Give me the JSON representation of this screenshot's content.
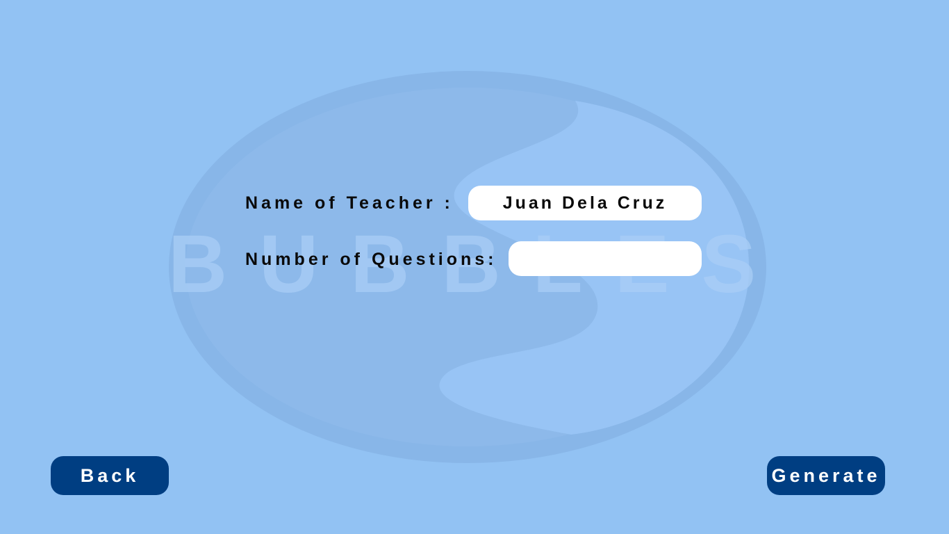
{
  "watermark": {
    "logo_text": "BUBBLES"
  },
  "form": {
    "teacher_label": "Name of Teacher :",
    "teacher_value": "Juan Dela Cruz",
    "questions_label": "Number of Questions:",
    "questions_value": ""
  },
  "buttons": {
    "back_label": "Back",
    "generate_label": "Generate"
  },
  "colors": {
    "background": "#92c2f3",
    "button": "#003e82",
    "field": "#ffffff"
  }
}
